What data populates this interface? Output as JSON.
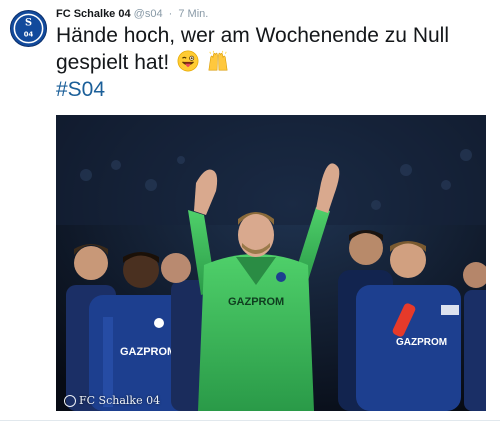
{
  "tweet": {
    "display_name": "FC Schalke 04",
    "handle": "@s04",
    "separator": "·",
    "time": "7 Min.",
    "text": "Hände hoch, wer am Wochenende zu Null gespielt hat!",
    "emojis": [
      "winking-face-with-tongue-emoji",
      "raising-hands-emoji"
    ],
    "hashtag": "#S04"
  },
  "avatar": {
    "logo_text": "S04"
  },
  "media": {
    "alt_subject": "Goalkeeper in green raising both hands, teammates in blue",
    "watermark": "FC Schalke 04",
    "sponsor": "GAZPROM",
    "colors": {
      "keeper": "#3bb55a",
      "team": "#1d3f8f",
      "background": "#0c1320"
    }
  },
  "colors": {
    "hashtag": "#1b5f99",
    "meta": "#8899a6",
    "brand": "#124a9c"
  }
}
